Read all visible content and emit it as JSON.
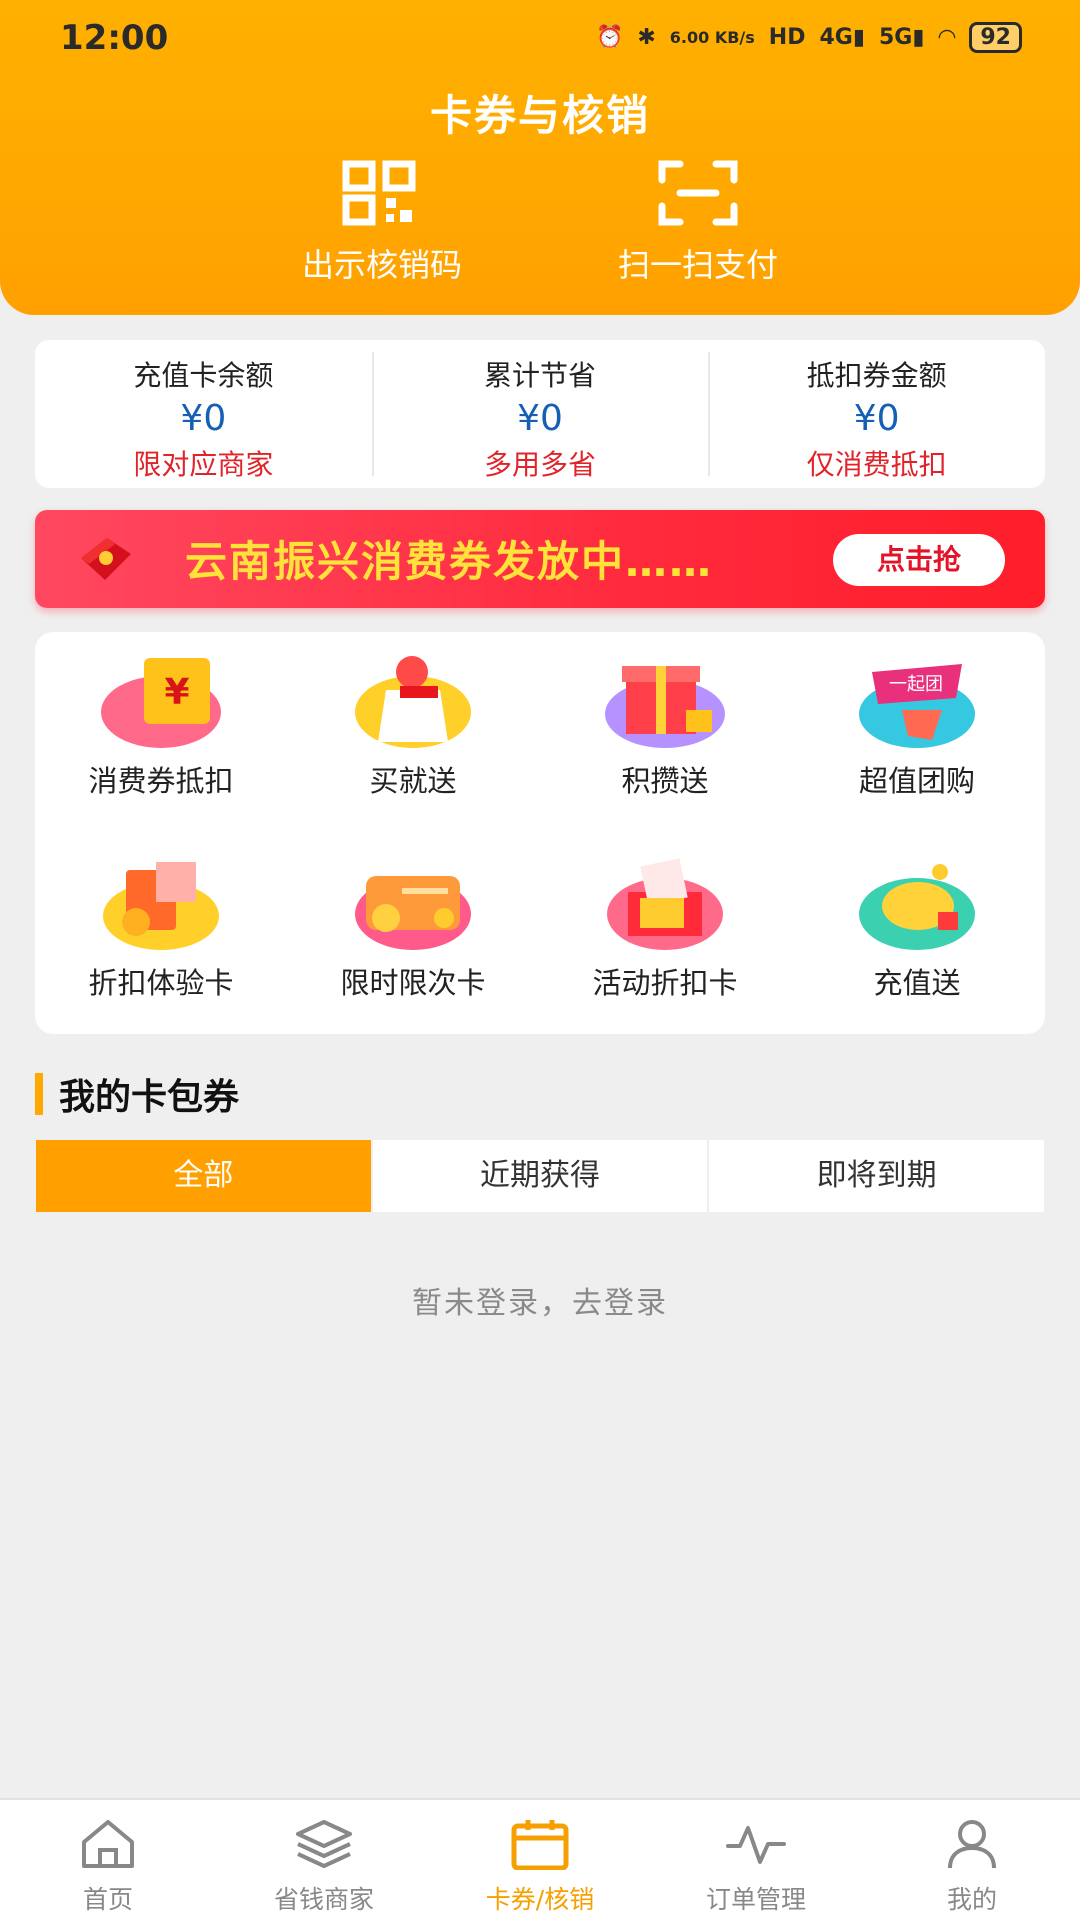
{
  "status_bar": {
    "time": "12:00",
    "net_speed": "6.00 KB/s",
    "battery": "92"
  },
  "header": {
    "title": "卡券与核销",
    "show_code_label": "出示核销码",
    "scan_pay_label": "扫一扫支付"
  },
  "stats": [
    {
      "title": "充值卡余额",
      "value": "¥0",
      "note": "限对应商家"
    },
    {
      "title": "累计节省",
      "value": "¥0",
      "note": "多用多省"
    },
    {
      "title": "抵扣券金额",
      "value": "¥0",
      "note": "仅消费抵扣"
    }
  ],
  "banner": {
    "text": "云南振兴消费券发放中……",
    "button": "点击抢"
  },
  "features": [
    {
      "label": "消费券抵扣",
      "icon": "coupon-deduct-icon"
    },
    {
      "label": "买就送",
      "icon": "buy-gift-icon"
    },
    {
      "label": "积攒送",
      "icon": "accumulate-gift-icon"
    },
    {
      "label": "超值团购",
      "icon": "group-buy-icon"
    },
    {
      "label": "折扣体验卡",
      "icon": "discount-trial-card-icon"
    },
    {
      "label": "限时限次卡",
      "icon": "time-limited-card-icon"
    },
    {
      "label": "活动折扣卡",
      "icon": "event-discount-card-icon"
    },
    {
      "label": "充值送",
      "icon": "recharge-gift-icon"
    }
  ],
  "wallet": {
    "title": "我的卡包券",
    "tabs": [
      "全部",
      "近期获得",
      "即将到期"
    ],
    "empty_text": "暂未登录，去登录"
  },
  "bottom_nav": [
    {
      "label": "首页",
      "icon": "home-icon"
    },
    {
      "label": "省钱商家",
      "icon": "layers-icon"
    },
    {
      "label": "卡券/核销",
      "icon": "calendar-icon"
    },
    {
      "label": "订单管理",
      "icon": "activity-icon"
    },
    {
      "label": "我的",
      "icon": "user-icon"
    }
  ],
  "colors": {
    "brand": "#ffa800",
    "price_blue": "#1560b5",
    "note_red": "#e0242a",
    "banner_red": "#ff2a3c"
  }
}
